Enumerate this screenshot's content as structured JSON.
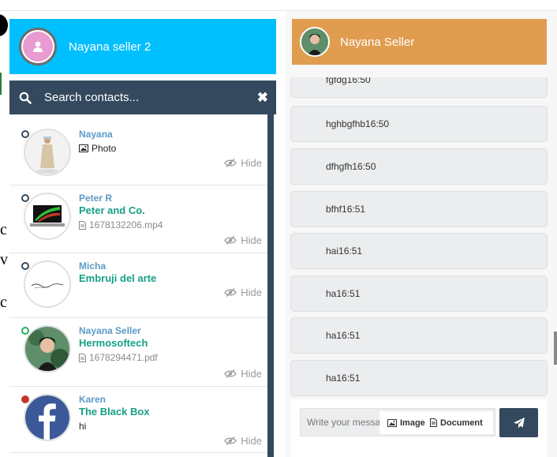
{
  "left": {
    "title": "Nayana seller 2",
    "search_placeholder": "Search contacts...",
    "close_symbol": "✖",
    "hide_label": "Hide",
    "contacts": [
      {
        "name": "Nayana",
        "company": "",
        "message": "Photo",
        "message_icon": "image-icon",
        "status": "offline"
      },
      {
        "name": "Peter R",
        "company": "Peter and Co.",
        "message": "1678132206.mp4",
        "message_icon": "file-icon",
        "status": "offline"
      },
      {
        "name": "Micha",
        "company": "Embruji del arte",
        "message": "",
        "message_icon": "",
        "status": "offline",
        "avatar_text": "embruji del arte"
      },
      {
        "name": "Nayana Seller",
        "company": "Hermosoftech",
        "message": "1678294471.pdf",
        "message_icon": "file-icon",
        "status": "online"
      },
      {
        "name": "Karen",
        "company": "The Black Box",
        "message": "hi",
        "message_icon": "",
        "status": "busy"
      }
    ]
  },
  "right": {
    "title": "Nayana Seller",
    "messages": [
      {
        "text": "fgfdg16:50"
      },
      {
        "text": "hghbgfhb16:50"
      },
      {
        "text": "dfhgfh16:50"
      },
      {
        "text": "bfhf16:51"
      },
      {
        "text": "hai16:51"
      },
      {
        "text": "ha16:51"
      },
      {
        "text": "ha16:51"
      },
      {
        "text": "ha16:51"
      }
    ],
    "composer": {
      "placeholder": "Write your message",
      "image_label": "Image",
      "document_label": "Document"
    }
  },
  "colors": {
    "left_header": "#00bfff",
    "right_header": "#e09c4f",
    "dark": "#34495e",
    "online": "#27ae60",
    "busy": "#c0392b",
    "name": "#5b9bc8",
    "company": "#16a085"
  }
}
